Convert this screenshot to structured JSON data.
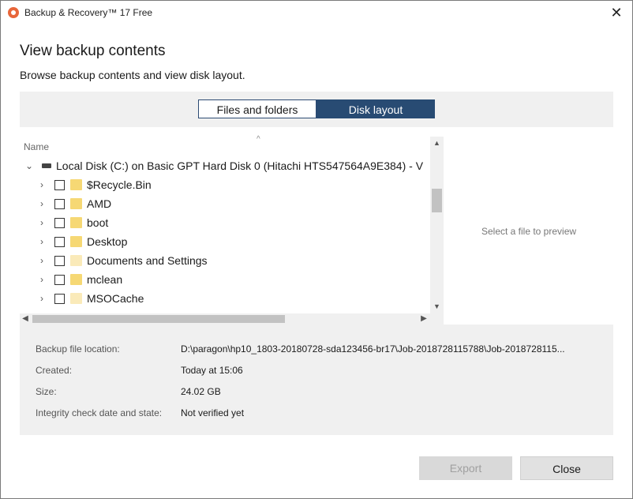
{
  "window": {
    "title": "Backup & Recovery™ 17 Free",
    "close_glyph": "✕"
  },
  "heading": "View backup contents",
  "subheading": "Browse backup contents and view disk layout.",
  "tabs": [
    {
      "label": "Files and folders",
      "active": false
    },
    {
      "label": "Disk layout",
      "active": true
    }
  ],
  "tree": {
    "column_name": "Name",
    "sort_arrow": "^",
    "root": {
      "label": "Local Disk (C:) on Basic GPT Hard Disk 0 (Hitachi HTS547564A9E384) - V",
      "expanded": true,
      "icon": "drive-icon"
    },
    "items": [
      {
        "label": "$Recycle.Bin",
        "checked": false
      },
      {
        "label": "AMD",
        "checked": false
      },
      {
        "label": "boot",
        "checked": false
      },
      {
        "label": "Desktop",
        "checked": false
      },
      {
        "label": "Documents and Settings",
        "checked": false
      },
      {
        "label": "mclean",
        "checked": false
      },
      {
        "label": "MSOCache",
        "checked": false
      }
    ]
  },
  "preview": {
    "placeholder": "Select a file to preview"
  },
  "info": {
    "location_label": "Backup file location:",
    "location_value": "D:\\paragon\\hp10_1803-20180728-sda123456-br17\\Job-2018728115788\\Job-2018728115...",
    "created_label": "Created:",
    "created_value": "Today at 15:06",
    "size_label": "Size:",
    "size_value": "24.02 GB",
    "integrity_label": "Integrity check date and state:",
    "integrity_value": "Not verified yet"
  },
  "buttons": {
    "export": "Export",
    "close": "Close"
  },
  "colors": {
    "accent": "#284b73",
    "panel_bg": "#f0f0f0",
    "folder": "#f6d874"
  }
}
